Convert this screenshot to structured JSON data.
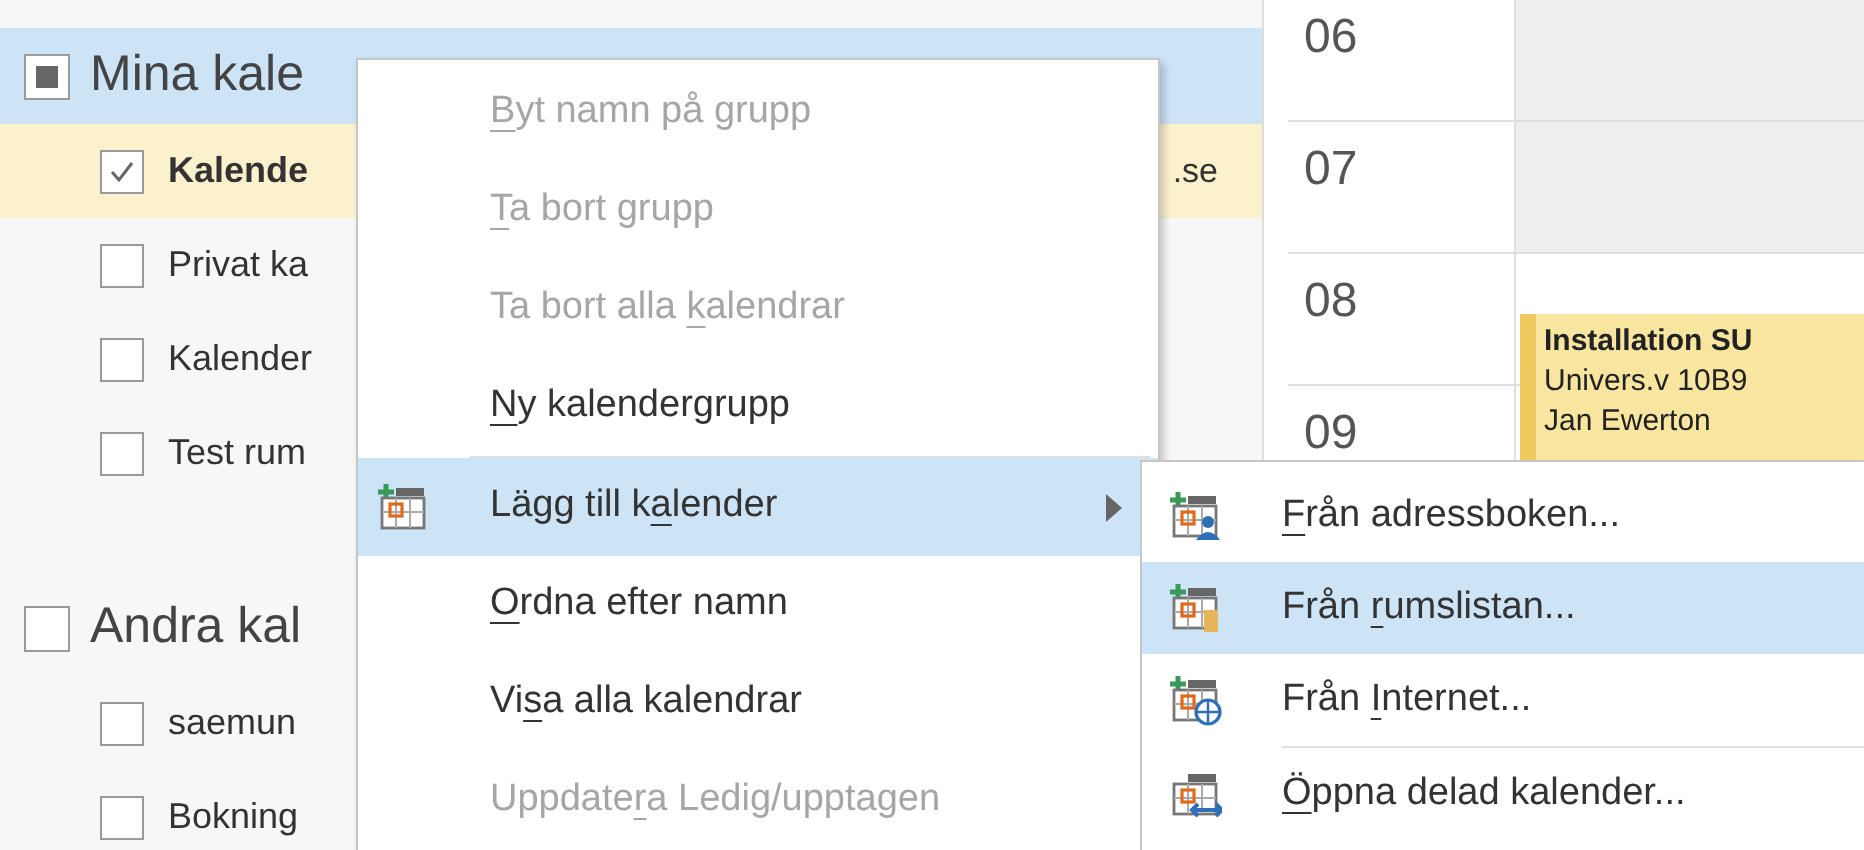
{
  "sidebar": {
    "groups": [
      {
        "label": "Mina kale",
        "mixed": true,
        "selected": true,
        "items": [
          {
            "label": "Kalende",
            "checked": true,
            "selected": true,
            "suffix": ".se"
          },
          {
            "label": "Privat ka",
            "checked": false,
            "selected": false
          },
          {
            "label": "Kalender",
            "checked": false,
            "selected": false
          },
          {
            "label": "Test rum",
            "checked": false,
            "selected": false
          }
        ]
      },
      {
        "label": "Andra kal",
        "checked": false,
        "mixed": false,
        "selected": false,
        "items": [
          {
            "label": "saemun",
            "checked": false,
            "selected": false
          },
          {
            "label": "Bokning",
            "checked": false,
            "selected": false
          }
        ]
      }
    ]
  },
  "calendar": {
    "hours": [
      {
        "label": "06",
        "busy": false
      },
      {
        "label": "07",
        "busy": false
      },
      {
        "label": "08",
        "busy": true
      },
      {
        "label": "09",
        "busy": true
      }
    ],
    "event": {
      "title": "Installation SU",
      "location": "Univers.v 10B9",
      "organizer": "Jan Ewerton"
    }
  },
  "context_menu": {
    "items": [
      {
        "key": "B",
        "post": "yt namn på grupp",
        "disabled": true,
        "selected": false,
        "submenu": false
      },
      {
        "key": "T",
        "post": "a bort grupp",
        "disabled": true,
        "selected": false,
        "submenu": false
      },
      {
        "pre": "Ta bort alla ",
        "key": "k",
        "post": "alendrar",
        "disabled": true,
        "selected": false,
        "submenu": false
      },
      {
        "key": "N",
        "post": "y kalendergrupp",
        "disabled": false,
        "selected": false,
        "submenu": false,
        "separator_after": true
      },
      {
        "pre": "Lägg till k",
        "key": "a",
        "post": "lender",
        "disabled": false,
        "selected": true,
        "submenu": true
      },
      {
        "key": "O",
        "post": "rdna efter namn",
        "disabled": false,
        "selected": false,
        "submenu": false
      },
      {
        "pre": "Vi",
        "key": "s",
        "post": "a alla kalendrar",
        "disabled": false,
        "selected": false,
        "submenu": false
      },
      {
        "pre": "Uppdate",
        "key": "r",
        "post": "a Ledig/upptagen",
        "disabled": true,
        "selected": false,
        "submenu": false
      }
    ]
  },
  "submenu": {
    "items": [
      {
        "key": "F",
        "post": "rån adressboken...",
        "selected": false
      },
      {
        "pre": "Från ",
        "key": "r",
        "post": "umslistan...",
        "selected": true
      },
      {
        "pre": "Från ",
        "key": "I",
        "post": "nternet...",
        "selected": false,
        "separator_after": true
      },
      {
        "key": "Ö",
        "post": "ppna delad kalender...",
        "selected": false
      }
    ]
  }
}
